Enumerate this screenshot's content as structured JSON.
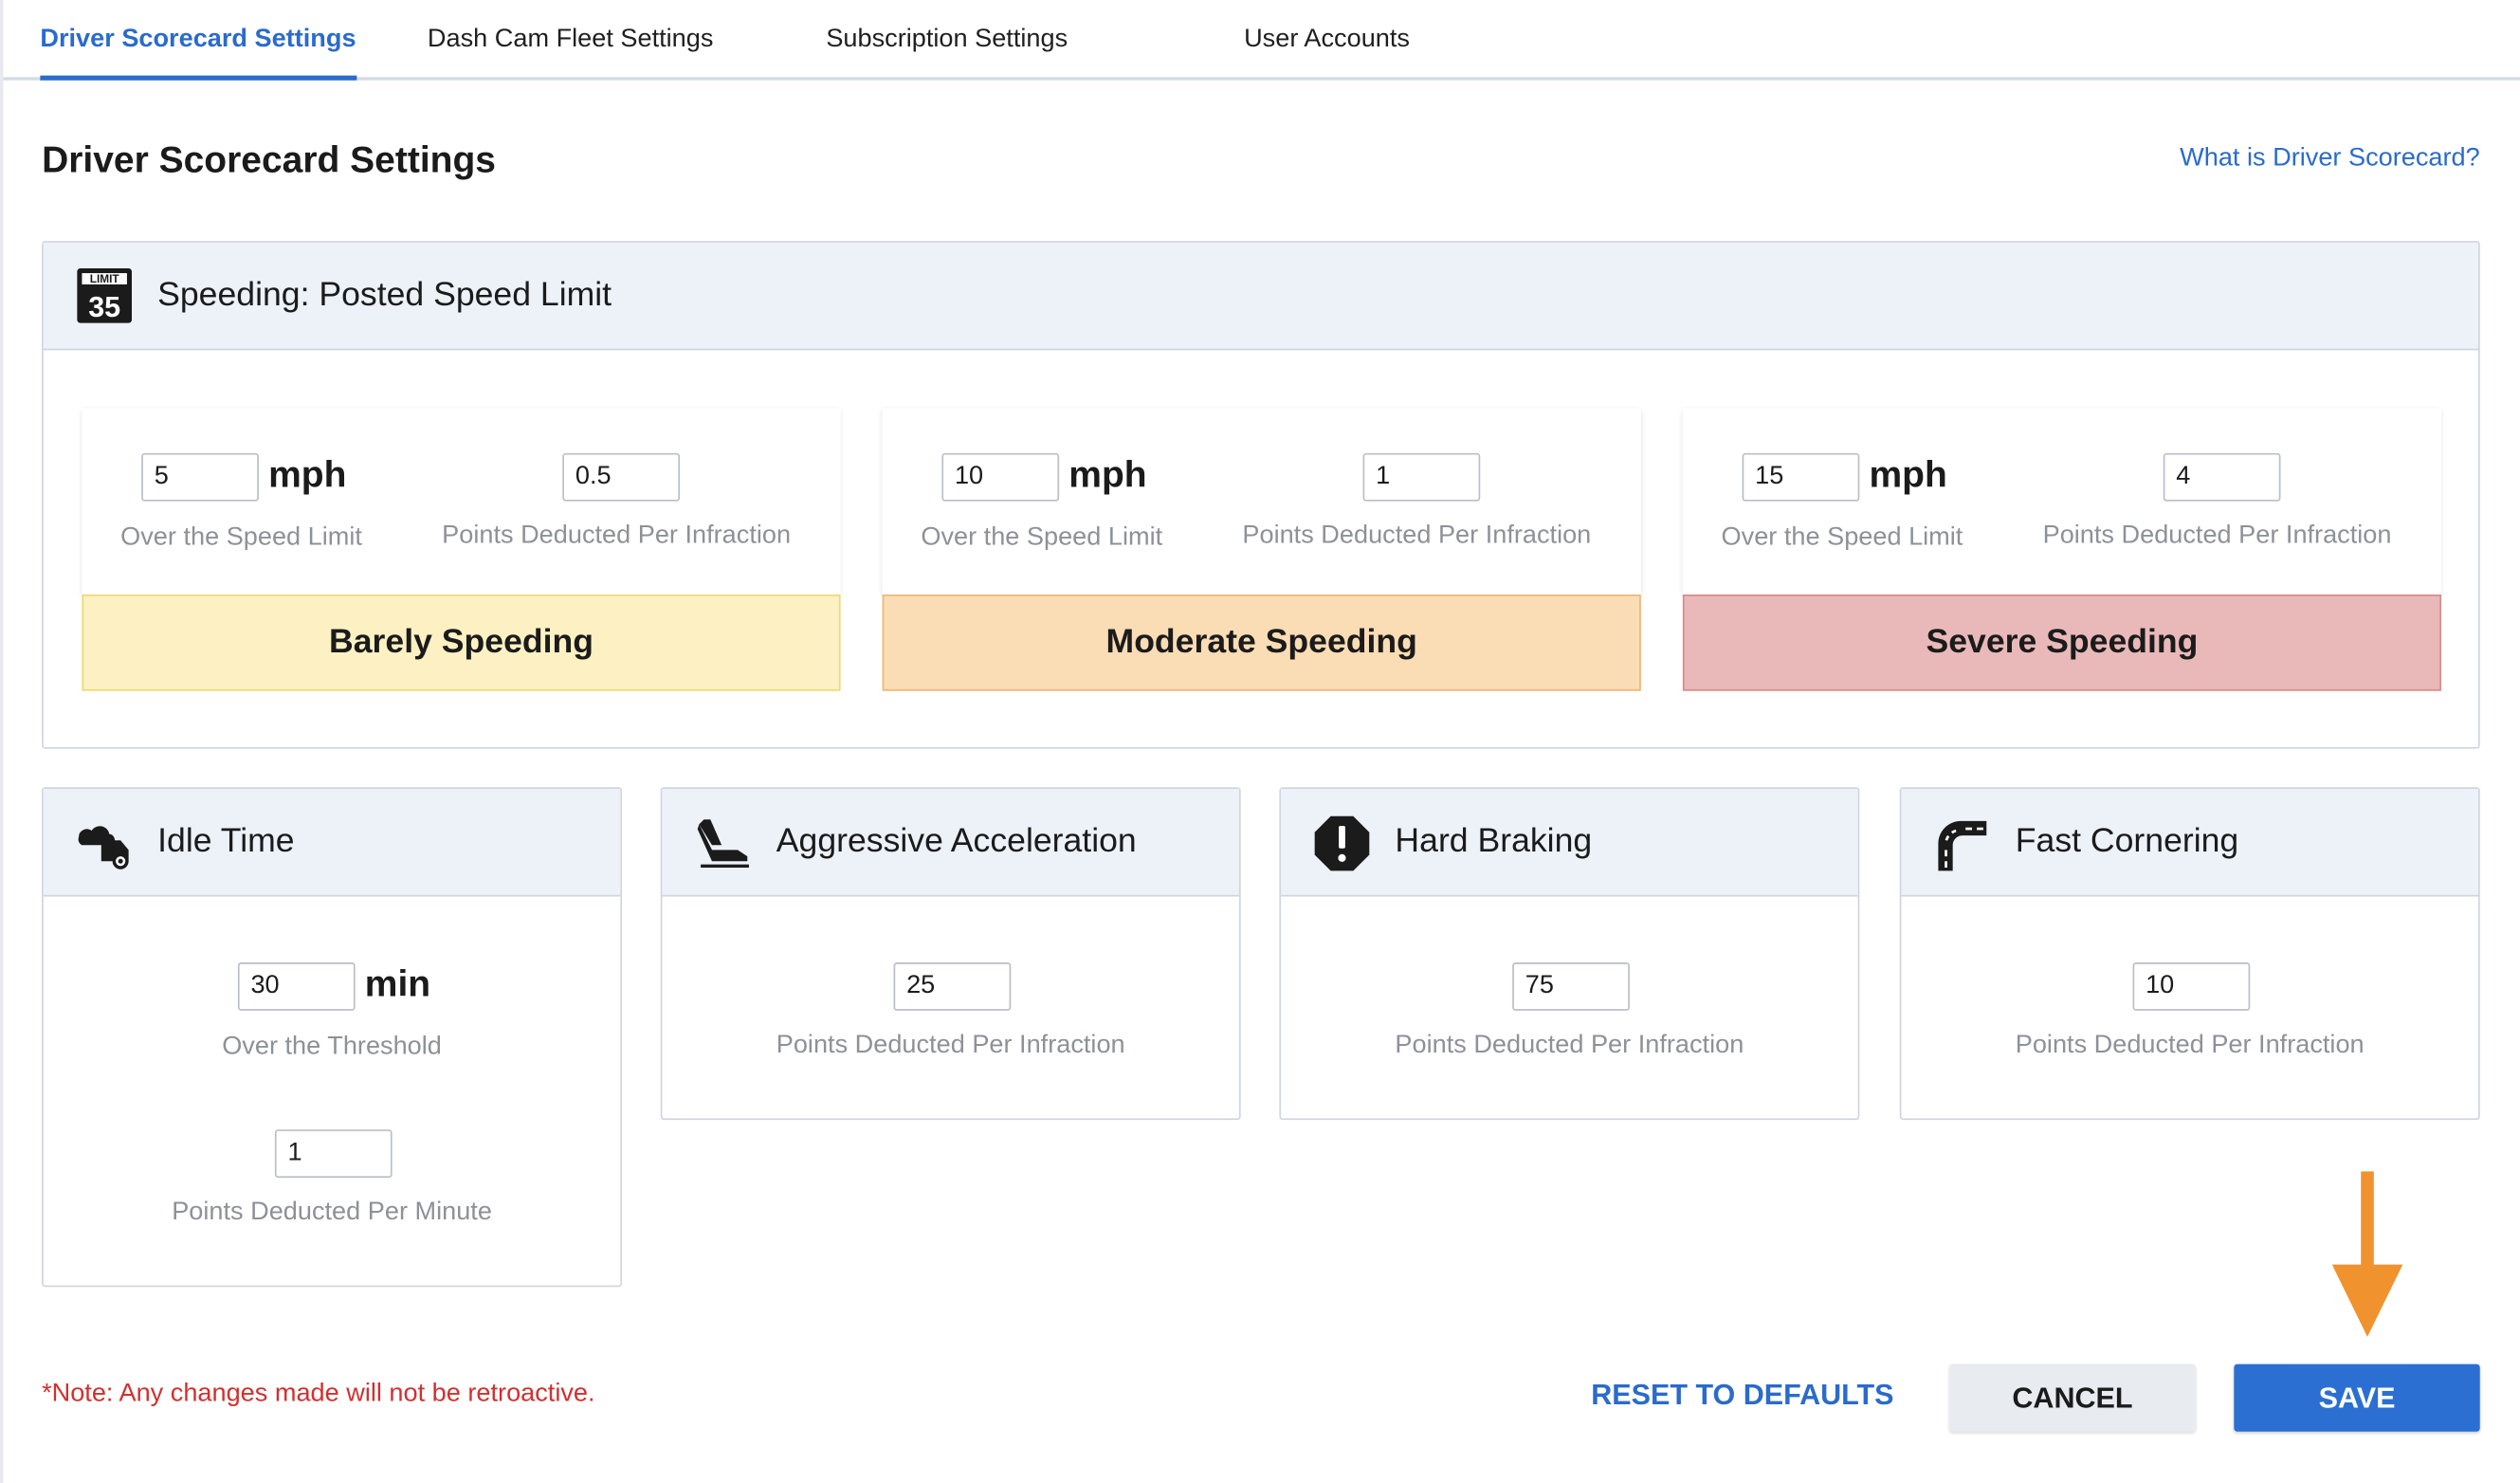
{
  "tabs": [
    {
      "label": "Driver Scorecard Settings",
      "active": true
    },
    {
      "label": "Dash Cam Fleet Settings",
      "active": false
    },
    {
      "label": "Subscription Settings",
      "active": false
    },
    {
      "label": "User Accounts",
      "active": false
    }
  ],
  "page": {
    "title": "Driver Scorecard Settings",
    "help_link": "What is Driver Scorecard?"
  },
  "speeding": {
    "title": "Speeding: Posted Speed Limit",
    "icon": "speed-limit-sign-icon",
    "icon_text_top": "LIMIT",
    "icon_text_num": "35",
    "levels": [
      {
        "mph": "5",
        "unit": "mph",
        "mph_caption": "Over the Speed Limit",
        "points": "0.5",
        "points_caption": "Points Deducted Per Infraction",
        "label": "Barely Speeding",
        "color": "#fdf1c3"
      },
      {
        "mph": "10",
        "unit": "mph",
        "mph_caption": "Over the Speed Limit",
        "points": "1",
        "points_caption": "Points Deducted Per Infraction",
        "label": "Moderate Speeding",
        "color": "#fadcb5"
      },
      {
        "mph": "15",
        "unit": "mph",
        "mph_caption": "Over the Speed Limit",
        "points": "4",
        "points_caption": "Points Deducted Per Infraction",
        "label": "Severe Speeding",
        "color": "#e9b9b9"
      }
    ]
  },
  "idle": {
    "title": "Idle Time",
    "icon": "idling-truck-icon",
    "threshold": "30",
    "unit": "min",
    "threshold_caption": "Over the Threshold",
    "points": "1",
    "points_caption": "Points Deducted Per Minute"
  },
  "acceleration": {
    "title": "Aggressive Acceleration",
    "icon": "gas-pedal-icon",
    "points": "25",
    "points_caption": "Points Deducted Per Infraction"
  },
  "braking": {
    "title": "Hard Braking",
    "icon": "alert-octagon-icon",
    "points": "75",
    "points_caption": "Points Deducted Per Infraction"
  },
  "cornering": {
    "title": "Fast Cornering",
    "icon": "curved-road-icon",
    "points": "10",
    "points_caption": "Points Deducted Per Infraction"
  },
  "footer": {
    "note": "*Note: Any changes made will not be retroactive.",
    "reset_label": "RESET TO DEFAULTS",
    "cancel_label": "CANCEL",
    "save_label": "SAVE"
  },
  "colors": {
    "accent": "#2a6bcc",
    "save_bg": "#2b6fd3",
    "note_red": "#d32f2f",
    "annotation_arrow": "#f0922e"
  }
}
